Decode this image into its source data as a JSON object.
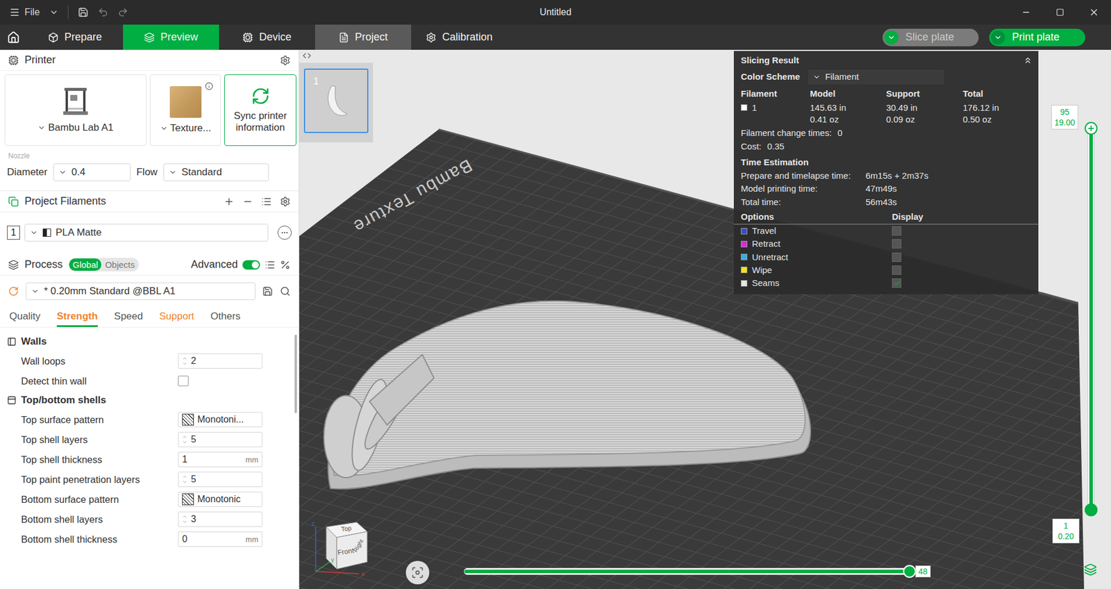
{
  "window": {
    "title": "Untitled",
    "menu": "File"
  },
  "nav_tabs": [
    {
      "label": "Prepare",
      "selected": false,
      "hovered": false
    },
    {
      "label": "Preview",
      "selected": true,
      "hovered": false
    },
    {
      "label": "Device",
      "selected": false,
      "hovered": false
    },
    {
      "label": "Project",
      "selected": false,
      "hovered": true
    },
    {
      "label": "Calibration",
      "selected": false,
      "hovered": false
    }
  ],
  "actions": [
    {
      "label": "Slice plate",
      "disabled": true
    },
    {
      "label": "Print plate",
      "disabled": false
    }
  ],
  "printer": {
    "title": "Printer",
    "cards": [
      {
        "kind": "printer",
        "label": "Bambu Lab A1"
      },
      {
        "kind": "plate",
        "label": "Texture..."
      },
      {
        "kind": "sync",
        "label": "Sync printer information"
      }
    ],
    "nozzle_label": "Nozzle",
    "diameter_label": "Diameter",
    "diameter": "0.4",
    "flow_label": "Flow",
    "flow": "Standard"
  },
  "filaments": {
    "title": "Project Filaments",
    "items": [
      {
        "index": "1",
        "name": "PLA Matte"
      }
    ]
  },
  "process": {
    "title": "Process",
    "scopes": [
      {
        "label": "Global",
        "selected": true
      },
      {
        "label": "Objects",
        "selected": false
      }
    ],
    "advanced_label": "Advanced",
    "advanced": true,
    "preset": "* 0.20mm Standard @BBL A1",
    "tabs": [
      {
        "label": "Quality",
        "selected": false,
        "modified": false
      },
      {
        "label": "Strength",
        "selected": true,
        "modified": true
      },
      {
        "label": "Speed",
        "selected": false,
        "modified": false
      },
      {
        "label": "Support",
        "selected": false,
        "modified": true
      },
      {
        "label": "Others",
        "selected": false,
        "modified": false
      }
    ],
    "sections": [
      {
        "title": "Walls",
        "rows": [
          {
            "kind": "spin",
            "label": "Wall loops",
            "value": "2"
          },
          {
            "kind": "check",
            "label": "Detect thin wall",
            "checked": false
          }
        ]
      },
      {
        "title": "Top/bottom shells",
        "rows": [
          {
            "kind": "select",
            "label": "Top surface pattern",
            "value": "Monotoni..."
          },
          {
            "kind": "spin",
            "label": "Top shell layers",
            "value": "5"
          },
          {
            "kind": "unit",
            "label": "Top shell thickness",
            "value": "1",
            "unit": "mm"
          },
          {
            "kind": "spin",
            "label": "Top paint penetration layers",
            "value": "5"
          },
          {
            "kind": "select",
            "label": "Bottom surface pattern",
            "value": "Monotonic"
          },
          {
            "kind": "spin",
            "label": "Bottom shell layers",
            "value": "3"
          },
          {
            "kind": "unit",
            "label": "Bottom shell thickness",
            "value": "0",
            "unit": "mm"
          }
        ]
      }
    ]
  },
  "plates": [
    {
      "number": "1",
      "selected": true
    }
  ],
  "bed_label": "Bambu Texture",
  "slicing_result": {
    "title": "Slicing Result",
    "color_scheme_label": "Color Scheme",
    "color_scheme": "Filament",
    "columns": [
      "Filament",
      "Model",
      "Support",
      "Total"
    ],
    "rows": [
      {
        "name": "1",
        "color": "#ffffff",
        "model": [
          "145.63 in",
          "0.41 oz"
        ],
        "support": [
          "30.49 in",
          "0.09 oz"
        ],
        "total": [
          "176.12 in",
          "0.50 oz"
        ]
      }
    ],
    "change_times_label": "Filament change times:",
    "change_times": "0",
    "cost_label": "Cost:",
    "cost": "0.35",
    "time_title": "Time Estimation",
    "times": [
      {
        "label": "Prepare and timelapse time:",
        "value": "6m15s + 2m37s"
      },
      {
        "label": "Model printing time:",
        "value": "47m49s"
      },
      {
        "label": "Total time:",
        "value": "56m43s"
      }
    ],
    "options_label": "Options",
    "display_label": "Display",
    "options": [
      {
        "label": "Travel",
        "color": "#3a4fc4",
        "checked": false
      },
      {
        "label": "Retract",
        "color": "#d92ad9",
        "checked": false
      },
      {
        "label": "Unretract",
        "color": "#3aaedc",
        "checked": false
      },
      {
        "label": "Wipe",
        "color": "#f2e41a",
        "checked": false
      },
      {
        "label": "Seams",
        "color": "#e6e6e6",
        "checked": true
      }
    ]
  },
  "layer_slider": {
    "top_layer": "95",
    "top_height": "19.00",
    "bottom_layer": "1",
    "bottom_height": "0.20",
    "level": 1
  },
  "move_slider": {
    "value": "48",
    "level": 1
  },
  "view_cube": {
    "top": "Top",
    "front": "Front",
    "right": "Right",
    "x": "x",
    "y": "y",
    "z": "z"
  }
}
